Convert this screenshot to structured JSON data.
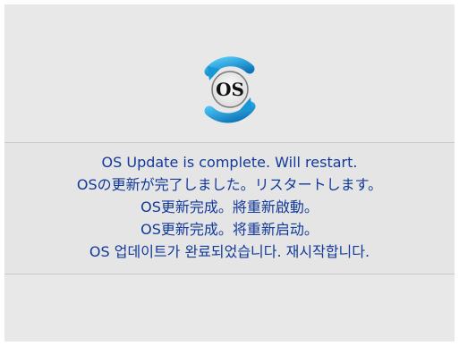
{
  "status": {
    "logo_icon": "os-update-sync-icon",
    "logo_text": "OS",
    "messages": [
      "OS Update is complete. Will restart.",
      "OSの更新が完了しました。リスタートします。",
      "OS更新完成。將重新啟動。",
      "OS更新完成。将重新启动。",
      "OS 업데이트가 완료되었습니다. 재시작합니다."
    ]
  },
  "colors": {
    "text": "#123a9a",
    "background": "#e8e8e8",
    "divider": "#c8c8c8",
    "logo_arrow": "#1597d8"
  }
}
